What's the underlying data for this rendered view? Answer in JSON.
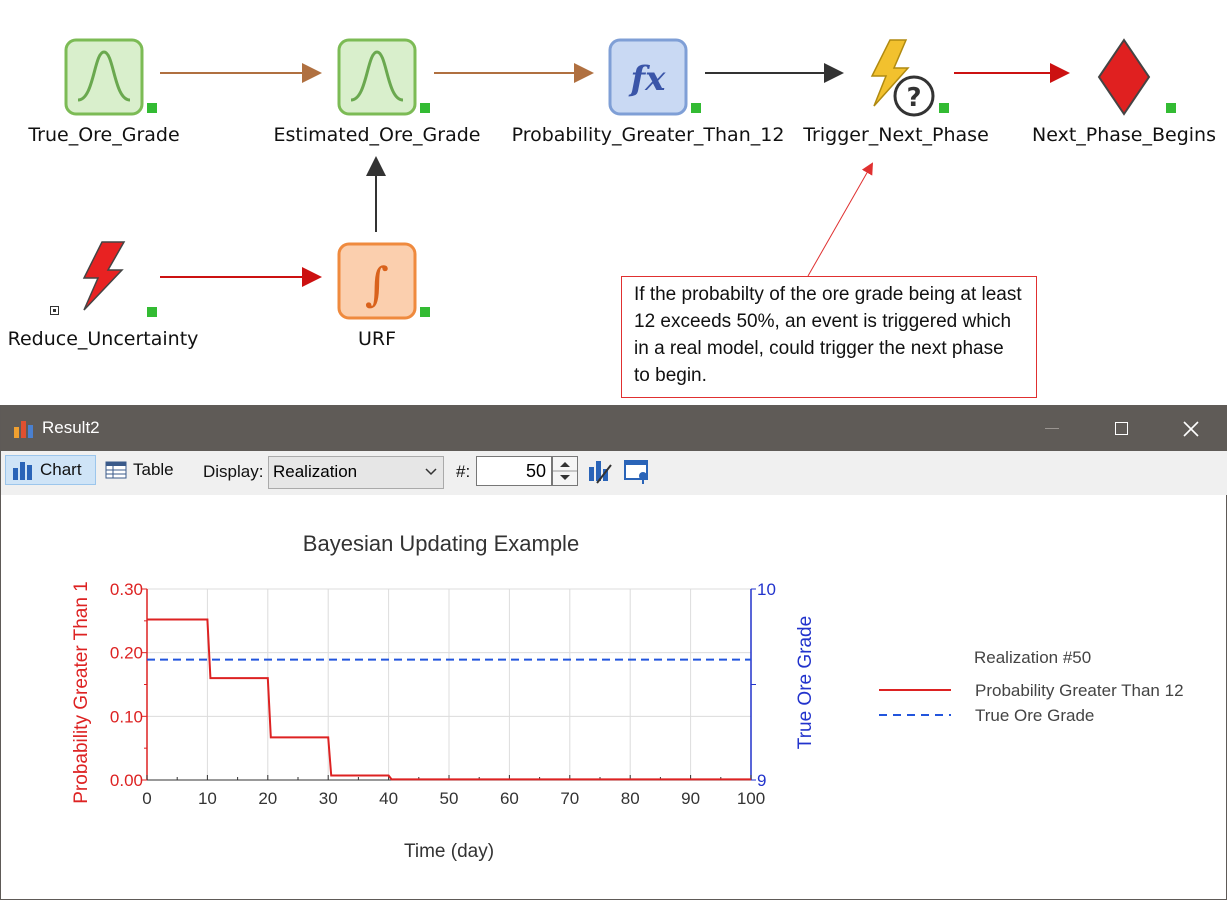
{
  "nodes": [
    {
      "label": "True_Ore_Grade"
    },
    {
      "label": "Estimated_Ore_Grade"
    },
    {
      "label": "Probability_Greater_Than_12"
    },
    {
      "label": "Trigger_Next_Phase"
    },
    {
      "label": "Next_Phase_Begins"
    },
    {
      "label": "Reduce_Uncertainty"
    },
    {
      "label": "URF"
    }
  ],
  "callout": {
    "text": "If the probabilty of the ore grade being at least 12 exceeds 50%, an event is triggered which in a real model, could trigger the next phase to begin."
  },
  "window": {
    "title": "Result2",
    "minimize_icon": "minimize-icon",
    "maximize_icon": "maximize-icon",
    "close_icon": "close-icon"
  },
  "toolbar": {
    "chart_label": "Chart",
    "table_label": "Table",
    "display_label": "Display:",
    "display_value": "Realization",
    "number_label": "#:",
    "number_value": "50"
  },
  "colors": {
    "red_series": "#dd2222",
    "blue_series": "#2255dd",
    "titlebar": "#5f5b57"
  },
  "chart_data": {
    "type": "line",
    "title": "Bayesian Updating Example",
    "xlabel": "Time (day)",
    "ylabel": "Probability Greater Than 1",
    "y2label": "True Ore Grade",
    "xlim": [
      0,
      100
    ],
    "ylim": [
      0,
      0.3
    ],
    "y2lim": [
      9,
      10
    ],
    "x_ticks": [
      "0",
      "10",
      "20",
      "30",
      "40",
      "50",
      "60",
      "70",
      "80",
      "90",
      "100"
    ],
    "y_ticks": [
      "0.00",
      "0.10",
      "0.20",
      "0.30"
    ],
    "y2_ticks": [
      "9",
      "10"
    ],
    "grid": true,
    "legend_title": "Realization #50",
    "legend_position": "right",
    "series": [
      {
        "name": "Probability Greater Than 12",
        "axis": "left",
        "style": "solid",
        "color": "#dd2222",
        "x": [
          0,
          10,
          10.5,
          20,
          20.5,
          30,
          30.5,
          40,
          40.5,
          100
        ],
        "y": [
          0.252,
          0.252,
          0.16,
          0.16,
          0.067,
          0.067,
          0.007,
          0.007,
          0.001,
          0.001
        ]
      },
      {
        "name": "True Ore Grade",
        "axis": "right",
        "style": "dashed",
        "color": "#2255dd",
        "x": [
          0,
          100
        ],
        "y": [
          9.63,
          9.63
        ]
      }
    ]
  }
}
